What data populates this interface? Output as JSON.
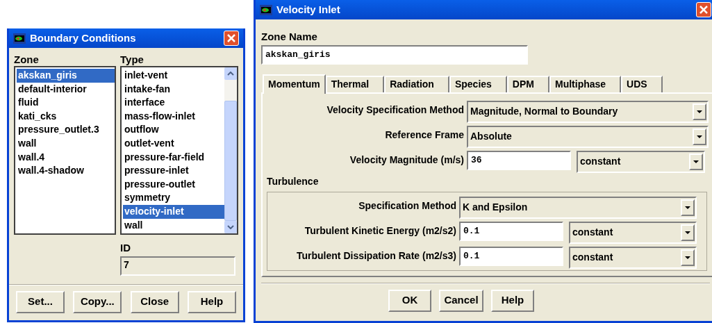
{
  "boundary_conditions": {
    "window": {
      "title": "Boundary Conditions"
    },
    "zone": {
      "label": "Zone",
      "items": [
        {
          "text": "akskan_giris",
          "selected": true
        },
        {
          "text": "default-interior",
          "selected": false
        },
        {
          "text": "fluid",
          "selected": false
        },
        {
          "text": "kati_cks",
          "selected": false
        },
        {
          "text": "pressure_outlet.3",
          "selected": false
        },
        {
          "text": "wall",
          "selected": false
        },
        {
          "text": "wall.4",
          "selected": false
        },
        {
          "text": "wall.4-shadow",
          "selected": false
        }
      ]
    },
    "type": {
      "label": "Type",
      "items": [
        {
          "text": "inlet-vent",
          "selected": false
        },
        {
          "text": "intake-fan",
          "selected": false
        },
        {
          "text": "interface",
          "selected": false
        },
        {
          "text": "mass-flow-inlet",
          "selected": false
        },
        {
          "text": "outflow",
          "selected": false
        },
        {
          "text": "outlet-vent",
          "selected": false
        },
        {
          "text": "pressure-far-field",
          "selected": false
        },
        {
          "text": "pressure-inlet",
          "selected": false
        },
        {
          "text": "pressure-outlet",
          "selected": false
        },
        {
          "text": "symmetry",
          "selected": false
        },
        {
          "text": "velocity-inlet",
          "selected": true
        },
        {
          "text": "wall",
          "selected": false
        }
      ]
    },
    "id": {
      "label": "ID",
      "value": "7"
    },
    "buttons": [
      "Set...",
      "Copy...",
      "Close",
      "Help"
    ]
  },
  "velocity_inlet": {
    "window": {
      "title": "Velocity Inlet"
    },
    "zone_name": {
      "label": "Zone Name",
      "value": "akskan_giris"
    },
    "tabs": [
      {
        "label": "Momentum",
        "selected": true
      },
      {
        "label": "Thermal",
        "selected": false
      },
      {
        "label": "Radiation",
        "selected": false
      },
      {
        "label": "Species",
        "selected": false
      },
      {
        "label": "DPM",
        "selected": false
      },
      {
        "label": "Multiphase",
        "selected": false
      },
      {
        "label": "UDS",
        "selected": false
      }
    ],
    "rows": [
      {
        "kind": "dropdown",
        "label": "Velocity Specification Method",
        "value": "Magnitude, Normal to Boundary"
      },
      {
        "kind": "dropdown",
        "label": "Reference Frame",
        "value": "Absolute"
      },
      {
        "kind": "field",
        "label": "Velocity Magnitude (m/s)",
        "value": "36",
        "option": "constant"
      }
    ],
    "turbulence": {
      "title": "Turbulence",
      "rows": [
        {
          "kind": "dropdown",
          "label": "Specification Method",
          "value": "K and Epsilon"
        },
        {
          "kind": "field",
          "label": "Turbulent Kinetic Energy (m2/s2)",
          "value": "0.1",
          "option": "constant"
        },
        {
          "kind": "field",
          "label": "Turbulent Dissipation Rate (m2/s3)",
          "value": "0.1",
          "option": "constant"
        }
      ]
    },
    "buttons": [
      "OK",
      "Cancel",
      "Help"
    ]
  }
}
